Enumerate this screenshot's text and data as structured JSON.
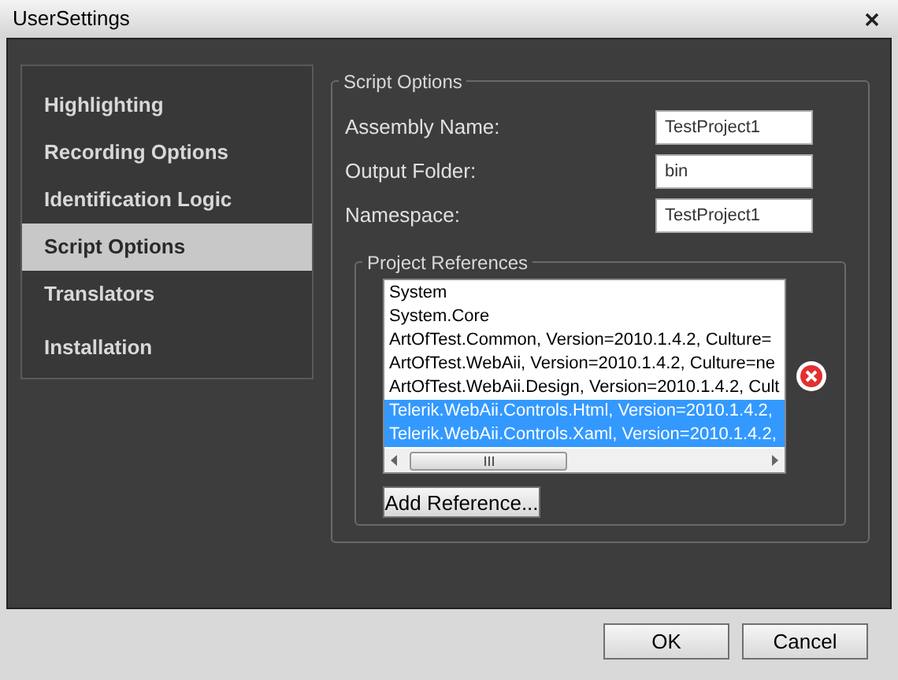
{
  "window": {
    "title": "UserSettings"
  },
  "nav": [
    {
      "label": "Highlighting",
      "selected": false
    },
    {
      "label": "Recording Options",
      "selected": false
    },
    {
      "label": "Identification Logic",
      "selected": false
    },
    {
      "label": "Script Options",
      "selected": true
    },
    {
      "label": "Translators",
      "selected": false
    },
    {
      "label": "Installation",
      "selected": false
    }
  ],
  "script_options": {
    "title": "Script Options",
    "fields": [
      {
        "label": "Assembly Name:",
        "value": "TestProject1"
      },
      {
        "label": "Output Folder:",
        "value": "bin"
      },
      {
        "label": "Namespace:",
        "value": "TestProject1"
      }
    ],
    "references": {
      "title": "Project References",
      "items": [
        {
          "text": "System",
          "selected": false
        },
        {
          "text": "System.Core",
          "selected": false
        },
        {
          "text": "ArtOfTest.Common, Version=2010.1.4.2, Culture=",
          "selected": false
        },
        {
          "text": "ArtOfTest.WebAii, Version=2010.1.4.2, Culture=ne",
          "selected": false
        },
        {
          "text": "ArtOfTest.WebAii.Design, Version=2010.1.4.2, Cult",
          "selected": false
        },
        {
          "text": "Telerik.WebAii.Controls.Html, Version=2010.1.4.2,",
          "selected": true
        },
        {
          "text": "Telerik.WebAii.Controls.Xaml, Version=2010.1.4.2,",
          "selected": true
        }
      ],
      "add_button": "Add Reference..."
    }
  },
  "buttons": [
    "OK",
    "Cancel"
  ]
}
